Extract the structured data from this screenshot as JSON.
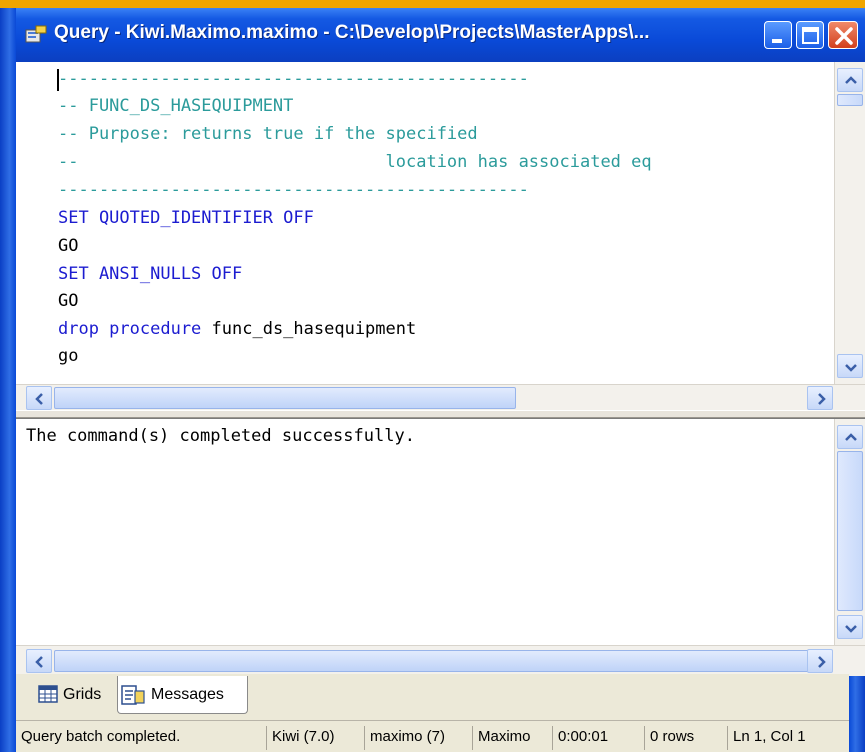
{
  "window": {
    "title": "Query - Kiwi.Maximo.maximo - C:\\Develop\\Projects\\MasterApps\\...",
    "minimize_icon": "minimize-icon",
    "maximize_icon": "maximize-icon",
    "close_icon": "close-icon"
  },
  "editor": {
    "lines": [
      {
        "text": "----------------------------------------------",
        "kind": "comment"
      },
      {
        "text": "-- FUNC_DS_HASEQUIPMENT",
        "kind": "comment"
      },
      {
        "text": "-- Purpose: returns true if the specified",
        "kind": "comment"
      },
      {
        "text": "--                              location has associated eq",
        "kind": "comment"
      },
      {
        "text": "----------------------------------------------",
        "kind": "comment"
      },
      {
        "text": "SET QUOTED_IDENTIFIER OFF",
        "kind": "keyword"
      },
      {
        "text": "GO",
        "kind": "plain"
      },
      {
        "text": "SET ANSI_NULLS OFF",
        "kind": "keyword"
      },
      {
        "text": "GO",
        "kind": "plain"
      },
      {
        "text_kw": "drop procedure ",
        "text_plain": "func_ds_hasequipment",
        "kind": "mixed"
      },
      {
        "text": "go",
        "kind": "plain"
      }
    ]
  },
  "results": {
    "message": "The command(s) completed successfully."
  },
  "tabs": {
    "grids": "Grids",
    "messages": "Messages"
  },
  "status": {
    "message": "Query batch completed.",
    "server": "Kiwi (7.0)",
    "user": "maximo (7)",
    "database": "Maximo",
    "elapsed": "0:00:01",
    "rows": "0 rows",
    "position": "Ln 1, Col 1"
  },
  "colors": {
    "titlebar": "#0a4ad8",
    "comment": "#2b9b9b",
    "keyword": "#1c1cd0",
    "chrome": "#ece9d8"
  }
}
